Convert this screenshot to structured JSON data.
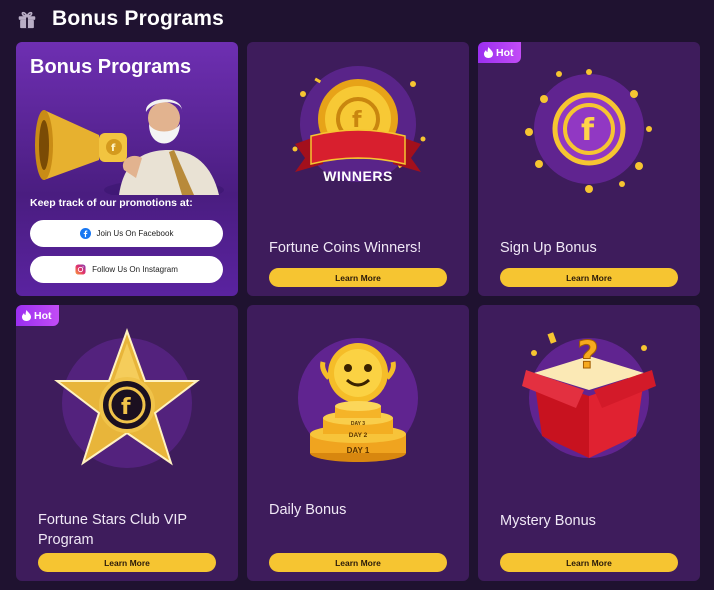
{
  "header": {
    "title": "Bonus Programs",
    "icon": "gift-icon"
  },
  "promo": {
    "title": "Bonus Programs",
    "tagline": "Keep track of our promotions at:",
    "facebook_label": "Join Us On Facebook",
    "instagram_label": "Follow Us On Instagram"
  },
  "cards": [
    {
      "title": "Fortune Coins Winners!",
      "button": "Learn More",
      "badge": "",
      "banner": "WINNERS"
    },
    {
      "title": "Sign Up Bonus",
      "button": "Learn More",
      "badge": "Hot"
    },
    {
      "title": "Fortune Stars Club VIP Program",
      "button": "Learn More",
      "badge": "Hot"
    },
    {
      "title": "Daily Bonus",
      "button": "Learn More",
      "badge": "",
      "steps": [
        "DAY 3",
        "DAY 2",
        "DAY 1"
      ]
    },
    {
      "title": "Mystery Bonus",
      "button": "Learn More",
      "badge": ""
    }
  ],
  "colors": {
    "background": "#1f1230",
    "card": "#3e1c5c",
    "button": "#f6c531",
    "hot": "#b23ef4"
  }
}
